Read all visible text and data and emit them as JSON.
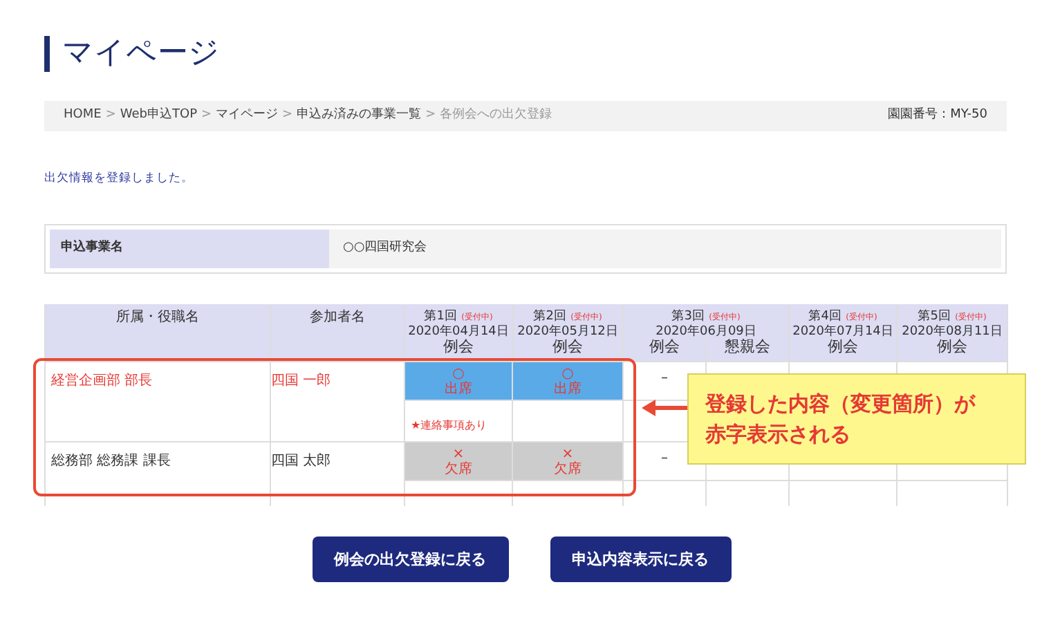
{
  "page_title": "マイページ",
  "breadcrumb": {
    "items": [
      {
        "label": "HOME",
        "current": false
      },
      {
        "label": "Web申込TOP",
        "current": false
      },
      {
        "label": "マイページ",
        "current": false
      },
      {
        "label": "申込み済みの事業一覧",
        "current": false
      },
      {
        "label": "各例会への出欠登録",
        "current": true
      }
    ],
    "separator": ">",
    "group_number": "園園番号：MY-50"
  },
  "message": "出欠情報を登録しました。",
  "info": {
    "label": "申込事業名",
    "value": "○○四国研究会"
  },
  "table": {
    "columns": [
      "所属・役職名",
      "参加者名"
    ],
    "rounds": [
      {
        "number": "第1回",
        "status": "(受付中)",
        "date": "2020年04月14日",
        "sessions": [
          "例会"
        ]
      },
      {
        "number": "第2回",
        "status": "(受付中)",
        "date": "2020年05月12日",
        "sessions": [
          "例会"
        ]
      },
      {
        "number": "第3回",
        "status": "(受付中)",
        "date": "2020年06月09日",
        "sessions": [
          "例会",
          "懇親会"
        ]
      },
      {
        "number": "第4回",
        "status": "(受付中)",
        "date": "2020年07月14日",
        "sessions": [
          "例会"
        ]
      },
      {
        "number": "第5回",
        "status": "(受付中)",
        "date": "2020年08月11日",
        "sessions": [
          "例会"
        ]
      }
    ],
    "rows": [
      {
        "affiliation": "経営企画部 部長",
        "name": "四国 一郎",
        "changed": true,
        "cells": [
          {
            "kind": "attend",
            "symbol": "○",
            "label": "出席",
            "note": "★連絡事項あり"
          },
          {
            "kind": "attend",
            "symbol": "○",
            "label": "出席"
          },
          {
            "kind": "dash",
            "symbol": "–"
          },
          {
            "kind": "empty"
          },
          {
            "kind": "empty"
          },
          {
            "kind": "empty"
          }
        ]
      },
      {
        "affiliation": "総務部 総務課 課長",
        "name": "四国 太郎",
        "changed": false,
        "cells": [
          {
            "kind": "absent",
            "symbol": "×",
            "label": "欠席"
          },
          {
            "kind": "absent",
            "symbol": "×",
            "label": "欠席"
          },
          {
            "kind": "dash",
            "symbol": "–"
          },
          {
            "kind": "empty"
          },
          {
            "kind": "empty"
          },
          {
            "kind": "empty"
          }
        ]
      }
    ]
  },
  "callout": {
    "lines": [
      "登録した内容（変更箇所）が",
      "赤字表示される"
    ]
  },
  "buttons": [
    "例会の出欠登録に戻る",
    "申込内容表示に戻る"
  ]
}
